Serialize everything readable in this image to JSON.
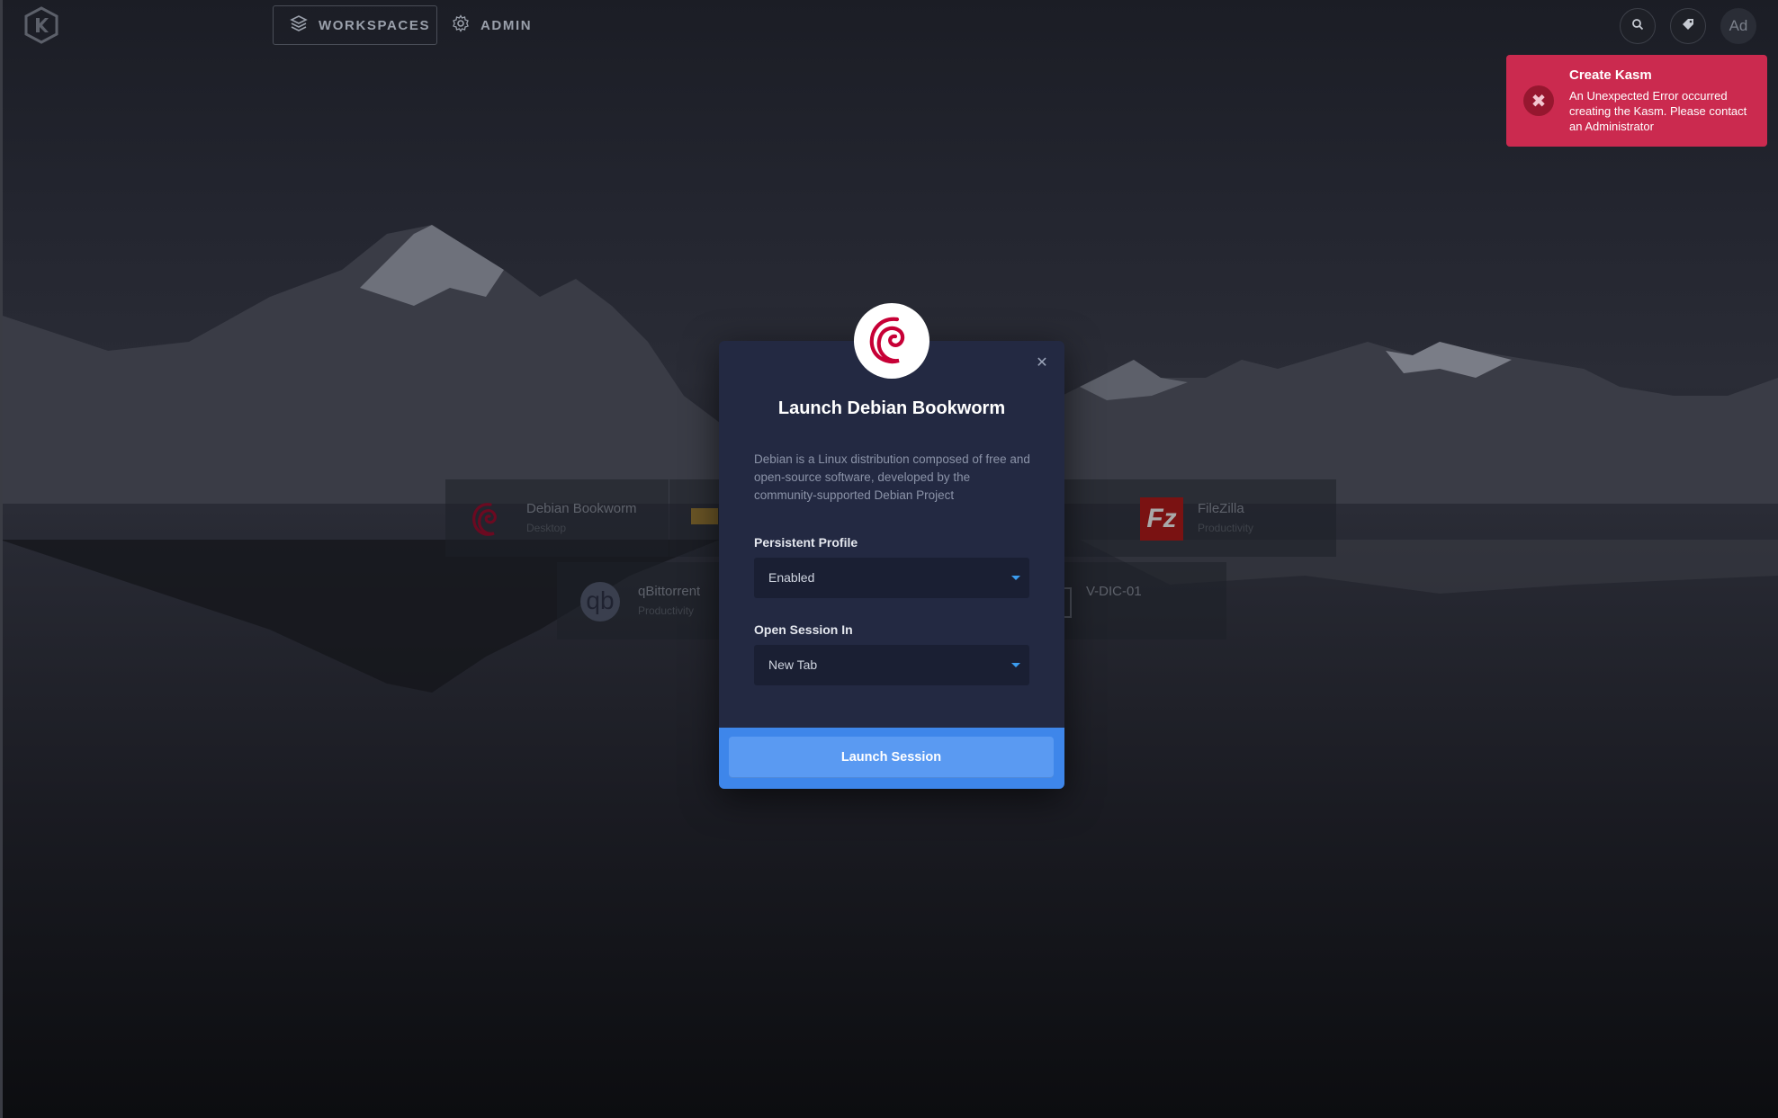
{
  "topbar": {
    "workspaces_label": "WORKSPACES",
    "admin_label": "ADMIN",
    "avatar_initials": "Ad"
  },
  "toast": {
    "title": "Create Kasm",
    "message": "An Unexpected Error occurred creating the Kasm. Please contact an Administrator"
  },
  "workspaces": [
    {
      "name": "Debian Bookworm",
      "category": "Desktop"
    },
    {
      "name": "FileZilla",
      "category": "Productivity"
    },
    {
      "name": "qBittorrent",
      "category": "Productivity"
    },
    {
      "name": "V-DIC-01",
      "category": ""
    }
  ],
  "modal": {
    "title": "Launch Debian Bookworm",
    "description": "Debian is a Linux distribution composed of free and open-source software, developed by the community-supported Debian Project",
    "persistent_profile": {
      "label": "Persistent Profile",
      "value": "Enabled"
    },
    "open_session_in": {
      "label": "Open Session In",
      "value": "New Tab"
    },
    "launch_label": "Launch Session"
  },
  "colors": {
    "toast_bg": "#cb2a4f",
    "modal_bg": "#232942",
    "launch_button": "#5a9af2",
    "debian_red": "#c70036"
  }
}
